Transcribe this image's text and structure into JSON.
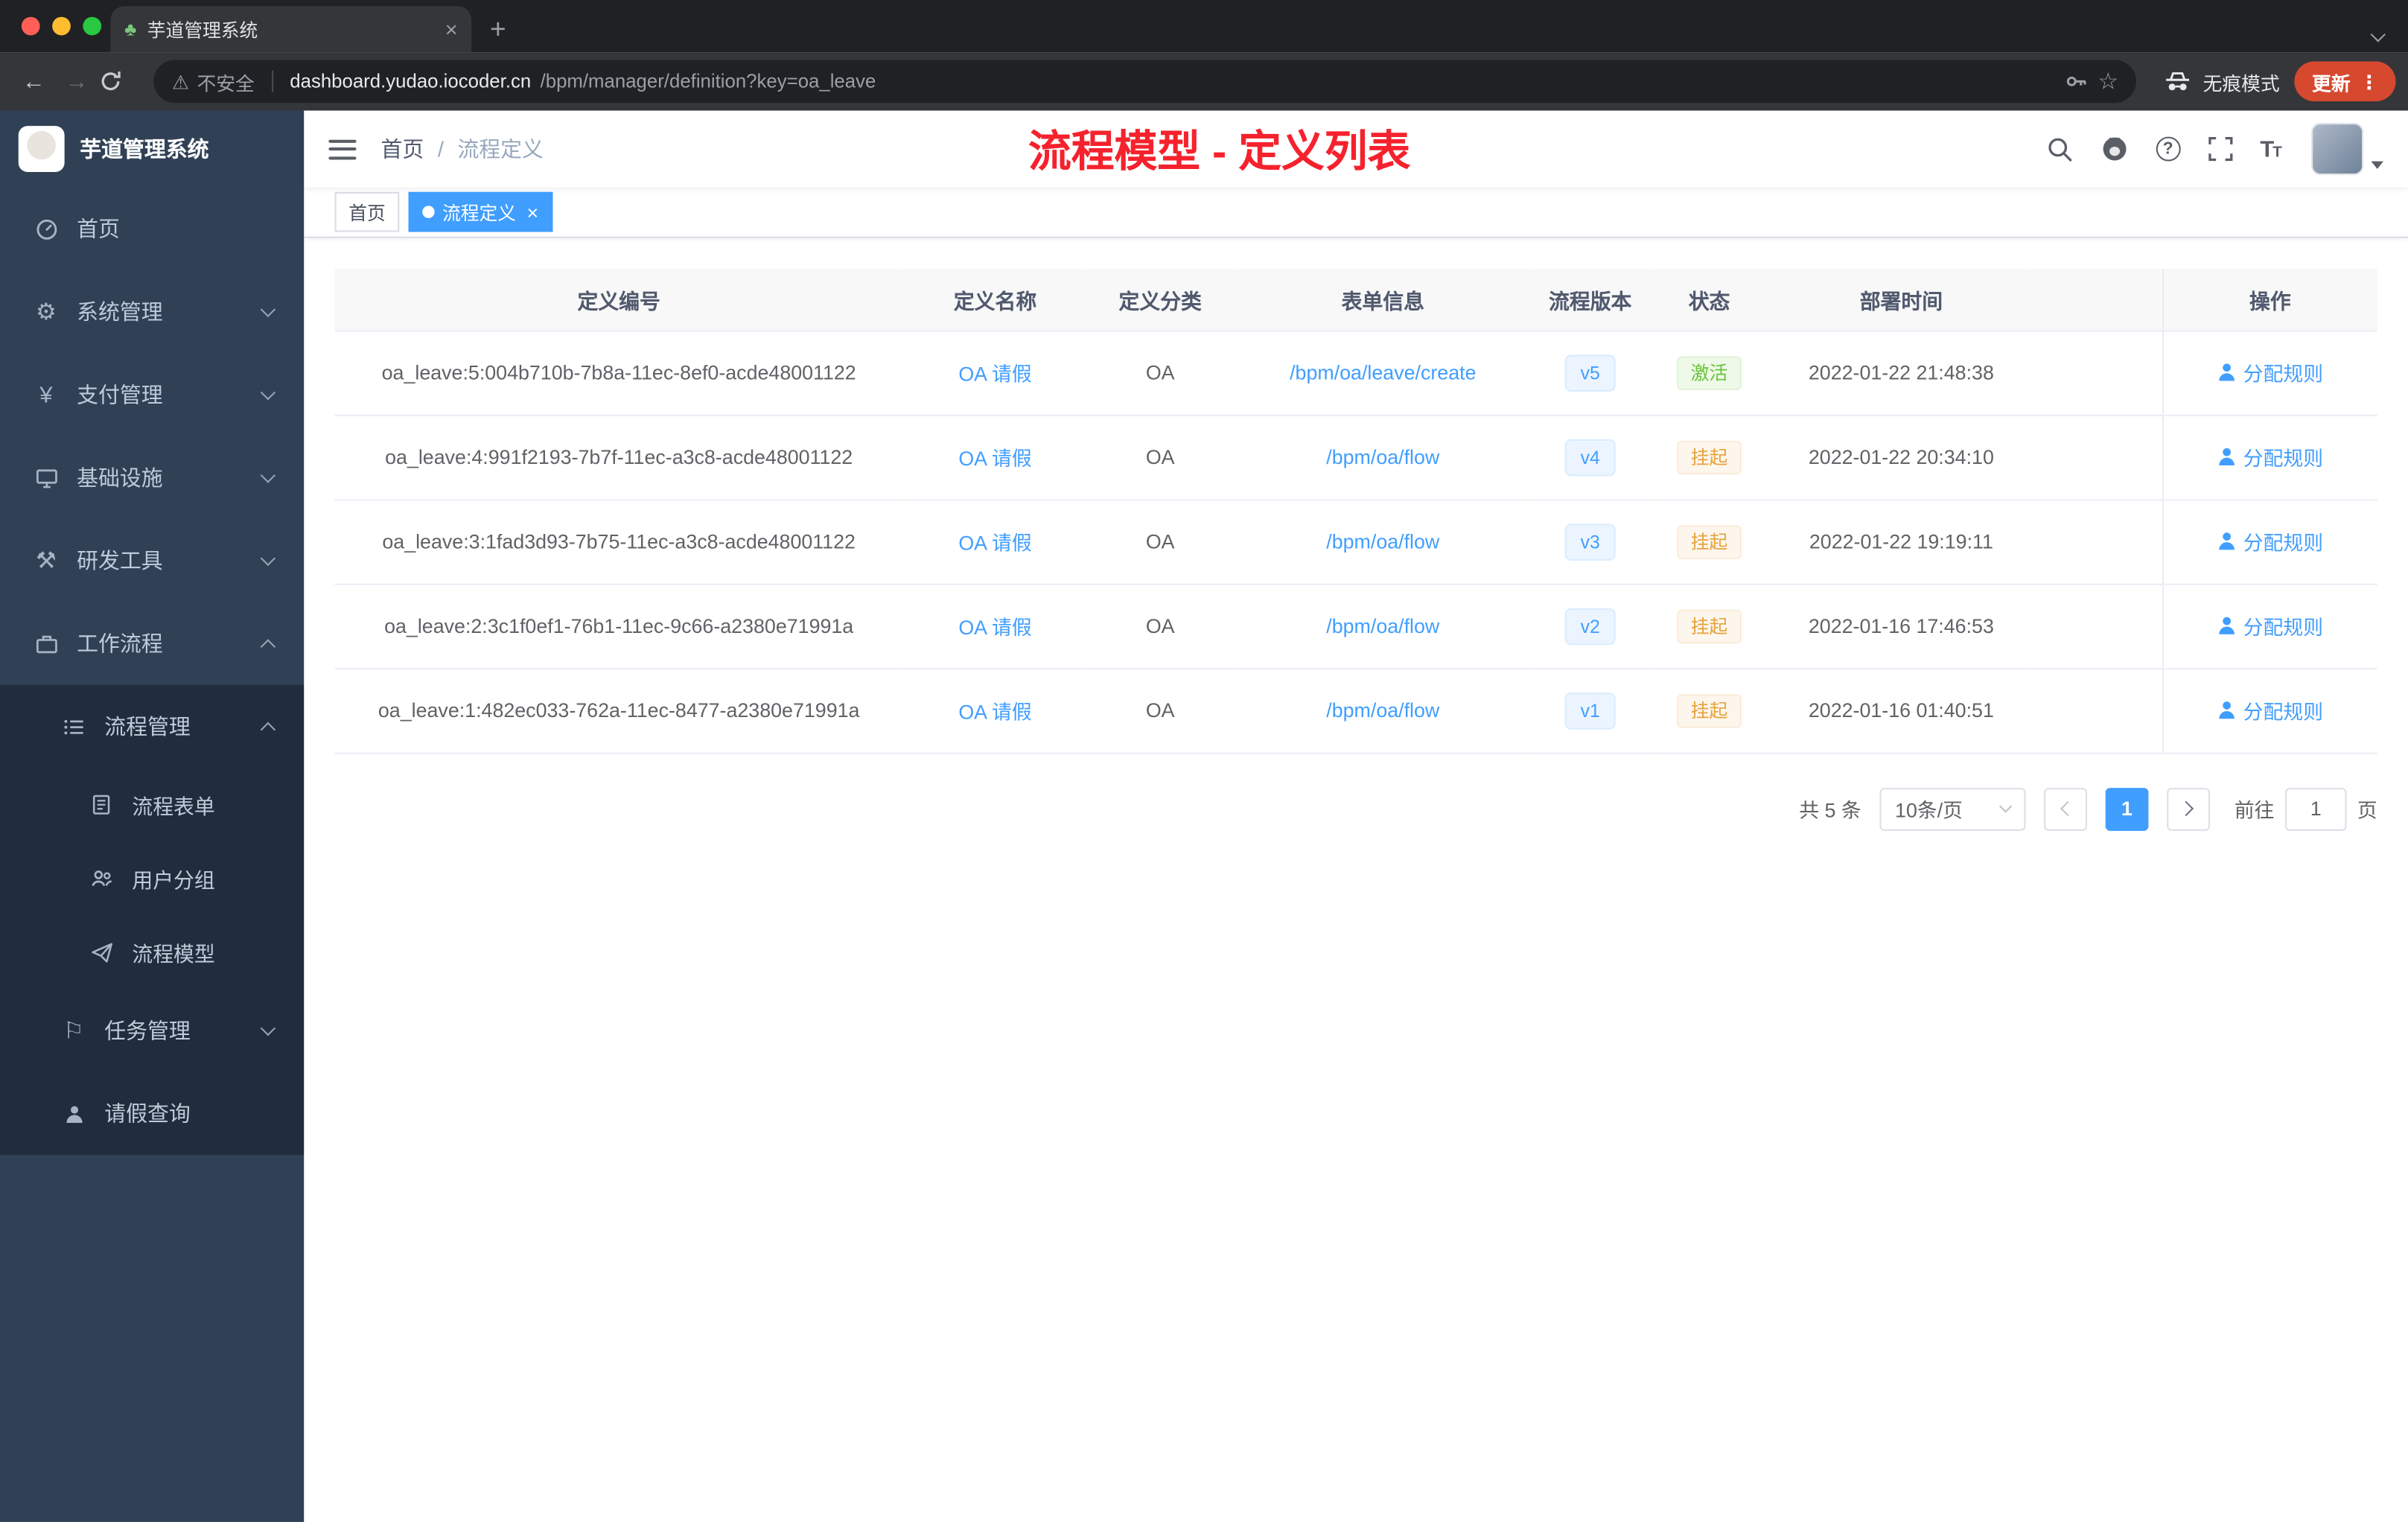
{
  "colors": {
    "accent_blue": "#409eff",
    "annotation_red": "#f5222d",
    "success_green": "#67c23a",
    "warning_orange": "#e6a23c",
    "sidebar_bg": "#304156",
    "submenu_bg": "#1f2d3d",
    "active_tag_bg": "#409eff",
    "update_button": "#d6492f"
  },
  "icons": {
    "gear": "⚙",
    "yen": "¥",
    "hammer": "⚒",
    "flag": "⚐",
    "warning": "⚠",
    "star": "☆",
    "back": "←",
    "forward": "→",
    "kebab": "⋮",
    "favicon": "♣",
    "close": "×",
    "plus": "+",
    "question": "?",
    "font_large": "T",
    "font_small": "T"
  },
  "browser": {
    "tab_title": "芋道管理系统",
    "security_label": "不安全",
    "url_host": "dashboard.yudao.iocoder.cn",
    "url_path": "/bpm/manager/definition?key=oa_leave",
    "incognito_label": "无痕模式",
    "update_label": "更新"
  },
  "sidebar": {
    "logo_title": "芋道管理系统",
    "items": [
      {
        "label": "首页"
      },
      {
        "label": "系统管理"
      },
      {
        "label": "支付管理"
      },
      {
        "label": "基础设施"
      },
      {
        "label": "研发工具"
      },
      {
        "label": "工作流程"
      },
      {
        "label": "流程管理"
      },
      {
        "label": "流程表单"
      },
      {
        "label": "用户分组"
      },
      {
        "label": "流程模型"
      },
      {
        "label": "任务管理"
      },
      {
        "label": "请假查询"
      }
    ]
  },
  "header": {
    "breadcrumb": [
      "首页",
      "流程定义"
    ],
    "separator": "/",
    "annotation": "流程模型 - 定义列表"
  },
  "tags": [
    {
      "label": "首页"
    },
    {
      "label": "流程定义"
    }
  ],
  "table": {
    "columns": [
      "定义编号",
      "定义名称",
      "定义分类",
      "表单信息",
      "流程版本",
      "状态",
      "部署时间",
      "操作"
    ],
    "rows": [
      {
        "id": "oa_leave:5:004b710b-7b8a-11ec-8ef0-acde48001122",
        "name": "OA 请假",
        "category": "OA",
        "form": "/bpm/oa/leave/create",
        "version": "v5",
        "status": "激活",
        "time": "2022-01-22 21:48:38",
        "action": "分配规则"
      },
      {
        "id": "oa_leave:4:991f2193-7b7f-11ec-a3c8-acde48001122",
        "name": "OA 请假",
        "category": "OA",
        "form": "/bpm/oa/flow",
        "version": "v4",
        "status": "挂起",
        "time": "2022-01-22 20:34:10",
        "action": "分配规则"
      },
      {
        "id": "oa_leave:3:1fad3d93-7b75-11ec-a3c8-acde48001122",
        "name": "OA 请假",
        "category": "OA",
        "form": "/bpm/oa/flow",
        "version": "v3",
        "status": "挂起",
        "time": "2022-01-22 19:19:11",
        "action": "分配规则"
      },
      {
        "id": "oa_leave:2:3c1f0ef1-76b1-11ec-9c66-a2380e71991a",
        "name": "OA 请假",
        "category": "OA",
        "form": "/bpm/oa/flow",
        "version": "v2",
        "status": "挂起",
        "time": "2022-01-16 17:46:53",
        "action": "分配规则"
      },
      {
        "id": "oa_leave:1:482ec033-762a-11ec-8477-a2380e71991a",
        "name": "OA 请假",
        "category": "OA",
        "form": "/bpm/oa/flow",
        "version": "v1",
        "status": "挂起",
        "time": "2022-01-16 01:40:51",
        "action": "分配规则"
      }
    ]
  },
  "pagination": {
    "total_label": "共 5 条",
    "page_size_label": "10条/页",
    "current_page": "1",
    "goto_label": "前往",
    "goto_value": "1",
    "page_unit": "页"
  }
}
